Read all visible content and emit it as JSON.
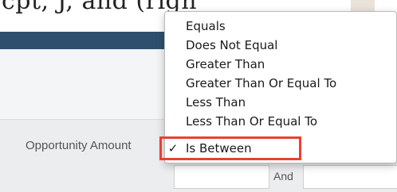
{
  "page": {
    "top_partial_text": "cpt, J, and (righ"
  },
  "field": {
    "label": "Opportunity Amount",
    "and_label": "And"
  },
  "operator_menu": {
    "items": [
      {
        "label": "Equals",
        "checked": false
      },
      {
        "label": "Does Not Equal",
        "checked": false
      },
      {
        "label": "Greater Than",
        "checked": false
      },
      {
        "label": "Greater Than Or Equal To",
        "checked": false
      },
      {
        "label": "Less Than",
        "checked": false
      },
      {
        "label": "Less Than Or Equal To",
        "checked": false
      },
      {
        "label": "Is Between",
        "checked": true
      }
    ],
    "check_glyph": "✓",
    "highlight_color": "#e8412f"
  },
  "colors": {
    "nav_bar": "#2f4f6e",
    "panel": "#f4f5f6",
    "field_row": "#ecedee"
  },
  "icons": {
    "select_arrow": "chevron-updown-icon"
  }
}
